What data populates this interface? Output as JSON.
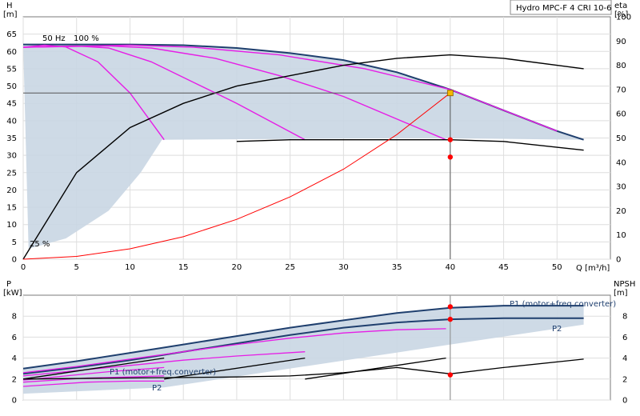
{
  "chart_data": [
    {
      "type": "line",
      "title": "Hydro MPC-F 4 CRI 10-6",
      "ylabel": "H",
      "yunit": "[m]",
      "ylabel_right": "eta",
      "yunit_right": "[%]",
      "xlabel": "Q [m³/h]",
      "xlim": [
        0,
        55
      ],
      "ylim": [
        0,
        70
      ],
      "ylim_right": [
        0,
        100
      ],
      "x_ticks": [
        0,
        5,
        10,
        15,
        20,
        25,
        30,
        35,
        40,
        45,
        50
      ],
      "y_ticks": [
        0,
        5,
        10,
        15,
        20,
        25,
        30,
        35,
        40,
        45,
        50,
        55,
        60,
        65
      ],
      "y_right_ticks": [
        0,
        10,
        20,
        30,
        40,
        50,
        60,
        70,
        80,
        90,
        100
      ],
      "grid": true,
      "annotations": [
        "50 Hz",
        "100 %",
        "25 %"
      ],
      "colors": {
        "envelope": "#c9d6e3",
        "max_curve": "#1f3f6e",
        "speed_curves": "#e61ee6",
        "efficiency": "#000000",
        "system": "#ff0000",
        "duty": "#ff0000",
        "duty_point": "#f5b800",
        "duty_lines": "#555555"
      },
      "duty_point": {
        "x": 40,
        "y": 48
      },
      "series": [
        {
          "role": "max_curve",
          "x": [
            0,
            5,
            10,
            15,
            20,
            25,
            30,
            35,
            40,
            45,
            50,
            52.5
          ],
          "y": [
            62,
            62,
            62,
            61.8,
            61,
            59.5,
            57.5,
            54,
            49,
            43,
            37,
            34.5
          ]
        },
        {
          "role": "speed_curve",
          "x": [
            0,
            2,
            4,
            7,
            10,
            13.2
          ],
          "y": [
            61.2,
            61.8,
            61.3,
            57,
            48,
            34.5
          ]
        },
        {
          "role": "speed_curve",
          "x": [
            0,
            5,
            8,
            12,
            16,
            20,
            26.4
          ],
          "y": [
            61.2,
            61.6,
            61,
            57,
            51,
            45,
            34.5
          ]
        },
        {
          "role": "speed_curve",
          "x": [
            0,
            8,
            12,
            18,
            24,
            30,
            39.6
          ],
          "y": [
            61.2,
            61.6,
            61,
            58,
            53,
            47,
            34.5
          ]
        },
        {
          "role": "speed_curve",
          "x": [
            0,
            10,
            16,
            24,
            32,
            40,
            50
          ],
          "y": [
            61.2,
            61.8,
            61.2,
            59,
            55,
            49,
            37
          ]
        },
        {
          "role": "efficiency",
          "x": [
            0,
            5,
            10,
            15,
            20,
            25,
            30,
            35,
            40,
            45,
            52.5
          ],
          "y": [
            0,
            25,
            38,
            45,
            50,
            53,
            56,
            58,
            59,
            58,
            55
          ]
        },
        {
          "role": "efficiency",
          "x": [
            20,
            25,
            30,
            35,
            40,
            45,
            52.5
          ],
          "y": [
            34,
            34.5,
            34.5,
            34.5,
            34.5,
            34,
            31.5
          ]
        },
        {
          "role": "system",
          "x": [
            0,
            5,
            10,
            15,
            20,
            25,
            30,
            35,
            40
          ],
          "y": [
            0,
            0.8,
            3,
            6.5,
            11.5,
            18,
            26,
            36,
            48
          ]
        },
        {
          "role": "duty_efficiency",
          "x": [
            40
          ],
          "y": [
            34.5
          ]
        },
        {
          "role": "duty_efficiency",
          "x": [
            40
          ],
          "y": [
            29.5
          ]
        }
      ]
    },
    {
      "type": "line",
      "ylabel": "P",
      "yunit": "[kW]",
      "ylabel_right": "NPSH",
      "yunit_right": "[m]",
      "xlim": [
        0,
        55
      ],
      "ylim": [
        0,
        10
      ],
      "ylim_right": [
        0,
        10
      ],
      "y_ticks": [
        0,
        2,
        4,
        6,
        8
      ],
      "y_right_ticks": [
        0,
        2,
        4,
        6,
        8
      ],
      "grid": true,
      "legend": [
        "P1 (motor+freq.converter)",
        "P2",
        "P1 (motor+freq.converter)",
        "P2"
      ],
      "series": [
        {
          "role": "p1_max",
          "name": "P1 (motor+freq.converter)",
          "x": [
            0,
            5,
            10,
            15,
            20,
            25,
            30,
            35,
            40,
            45,
            52.5
          ],
          "y": [
            3.0,
            3.7,
            4.5,
            5.3,
            6.1,
            6.9,
            7.6,
            8.3,
            8.8,
            9.0,
            9.0
          ]
        },
        {
          "role": "p2_max",
          "name": "P2",
          "x": [
            0,
            5,
            10,
            15,
            20,
            25,
            30,
            35,
            40,
            45,
            52.5
          ],
          "y": [
            2.5,
            3.1,
            3.8,
            4.6,
            5.4,
            6.2,
            6.9,
            7.4,
            7.7,
            7.8,
            7.8
          ]
        },
        {
          "role": "p_speed",
          "x": [
            0,
            5,
            10,
            15,
            20,
            25,
            30,
            35,
            39.6
          ],
          "y": [
            2.6,
            3.2,
            3.9,
            4.6,
            5.3,
            5.9,
            6.4,
            6.7,
            6.8
          ]
        },
        {
          "role": "p_speed",
          "x": [
            0,
            5,
            10,
            15,
            20,
            26.4
          ],
          "y": [
            2.3,
            2.8,
            3.3,
            3.8,
            4.2,
            4.6
          ]
        },
        {
          "role": "p_speed",
          "x": [
            0,
            4,
            8,
            13.2
          ],
          "y": [
            1.9,
            2.3,
            2.7,
            3.1
          ]
        },
        {
          "role": "p_speed_low",
          "name": "P1 (motor+freq.converter)",
          "x": [
            0,
            3,
            6,
            10,
            13.2
          ],
          "y": [
            1.7,
            1.9,
            2.1,
            2.2,
            2.3
          ]
        },
        {
          "role": "p_speed_low",
          "name": "P2",
          "x": [
            0,
            3,
            6,
            10,
            13.2
          ],
          "y": [
            1.3,
            1.5,
            1.7,
            1.8,
            1.8
          ]
        },
        {
          "role": "npsh",
          "x": [
            0,
            10,
            20,
            25,
            30,
            35,
            40,
            45,
            52.5
          ],
          "y": [
            2.0,
            2.1,
            2.2,
            2.3,
            2.6,
            3.1,
            2.5,
            3.1,
            3.9
          ]
        },
        {
          "role": "npsh_multi",
          "x": [
            0,
            13.2
          ],
          "y": [
            2.0,
            4.0
          ]
        },
        {
          "role": "npsh_multi",
          "x": [
            13.2,
            26.4
          ],
          "y": [
            2.0,
            4.0
          ]
        },
        {
          "role": "npsh_multi",
          "x": [
            26.4,
            39.6
          ],
          "y": [
            2.0,
            4.0
          ]
        }
      ],
      "duty_points": [
        {
          "x": 40,
          "y": 8.9
        },
        {
          "x": 40,
          "y": 7.7
        },
        {
          "x": 40,
          "y": 2.4
        }
      ]
    }
  ]
}
